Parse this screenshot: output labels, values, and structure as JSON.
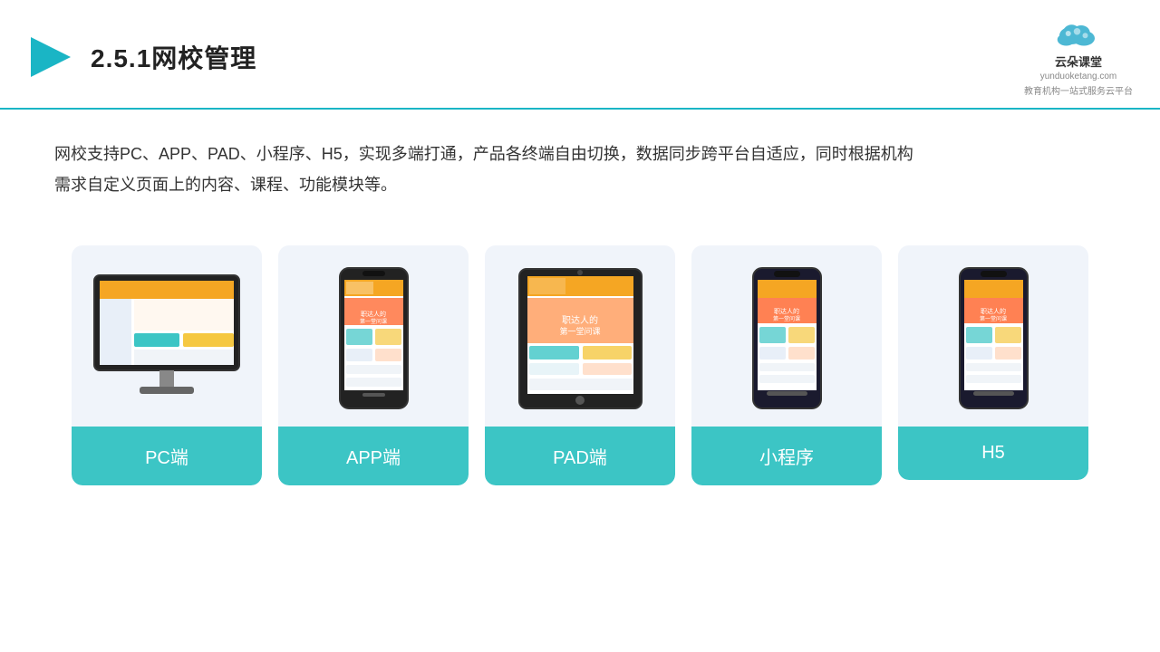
{
  "header": {
    "title": "2.5.1网校管理",
    "logo_url": "yunduoketang.com",
    "logo_tagline": "教育机构一站\n式服务云平台",
    "logo_name": "云朵课堂"
  },
  "description": {
    "text": "网校支持PC、APP、PAD、小程序、H5，实现多端打通，产品各终端自由切换，数据同步跨平台自适应，同时根据机构需求自定义页面上的内容、课程、功能模块等。"
  },
  "cards": [
    {
      "id": "pc",
      "label": "PC端"
    },
    {
      "id": "app",
      "label": "APP端"
    },
    {
      "id": "pad",
      "label": "PAD端"
    },
    {
      "id": "miniprogram",
      "label": "小程序"
    },
    {
      "id": "h5",
      "label": "H5"
    }
  ],
  "colors": {
    "accent": "#3cc5c5",
    "header_border": "#1ab5c5",
    "card_bg": "#f0f4fa",
    "title": "#222333"
  }
}
